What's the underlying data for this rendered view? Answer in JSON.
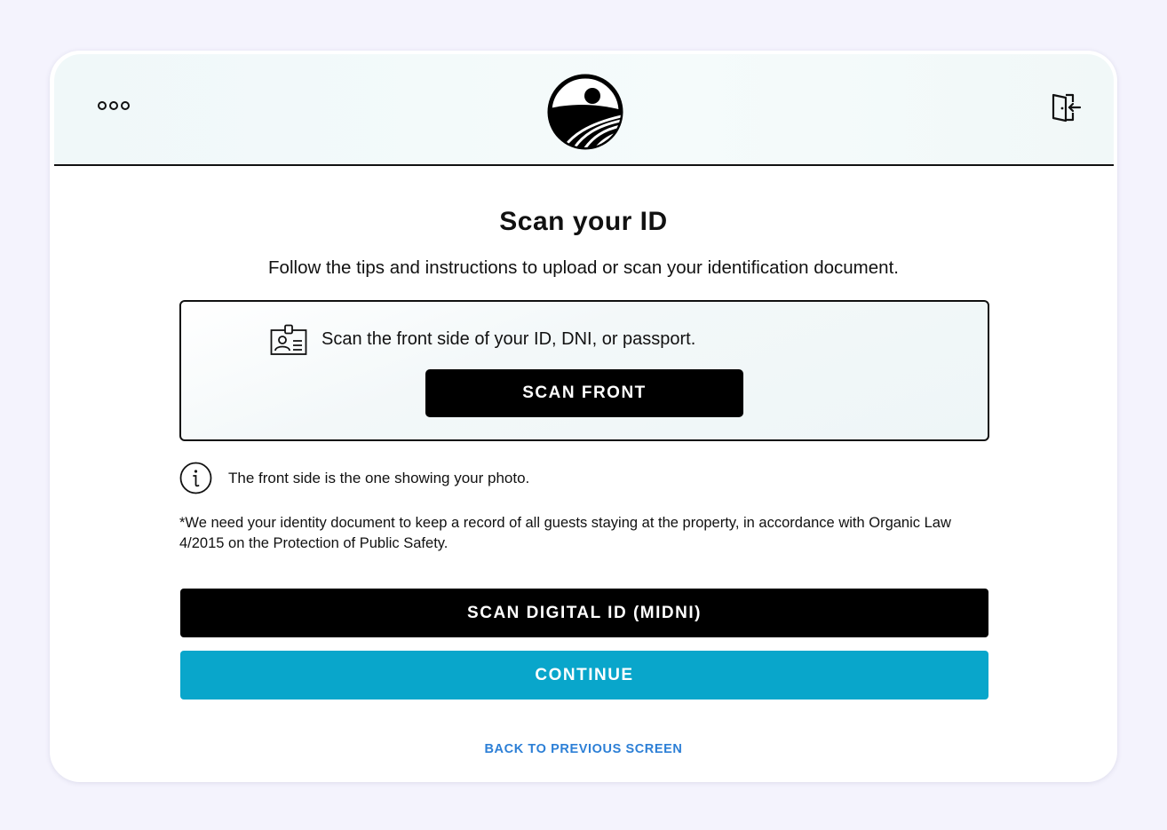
{
  "header": {
    "menu_icon": "more-dots-icon",
    "logo_icon": "sunset-field-logo",
    "logout_icon": "logout-door-icon"
  },
  "main": {
    "title": "Scan your ID",
    "subtitle": "Follow the tips and instructions to upload or scan your identification document."
  },
  "scan_box": {
    "icon": "id-card-icon",
    "instruction": "Scan the front side of your ID, DNI, or passport.",
    "button_label": "SCAN FRONT"
  },
  "info": {
    "icon": "info-circle-icon",
    "text": "The front side is the one showing your photo."
  },
  "legal_note": "*We need your identity document to keep a record of all guests staying at the property, in accordance with Organic Law 4/2015 on the Protection of Public Safety.",
  "actions": {
    "digital_id_label": "SCAN DIGITAL ID (MIDNI)",
    "continue_label": "CONTINUE",
    "back_label": "BACK TO PREVIOUS SCREEN"
  },
  "colors": {
    "primary": "#000000",
    "accent": "#09a6cb",
    "link": "#2c7fd6",
    "background": "#f4f3fd"
  }
}
